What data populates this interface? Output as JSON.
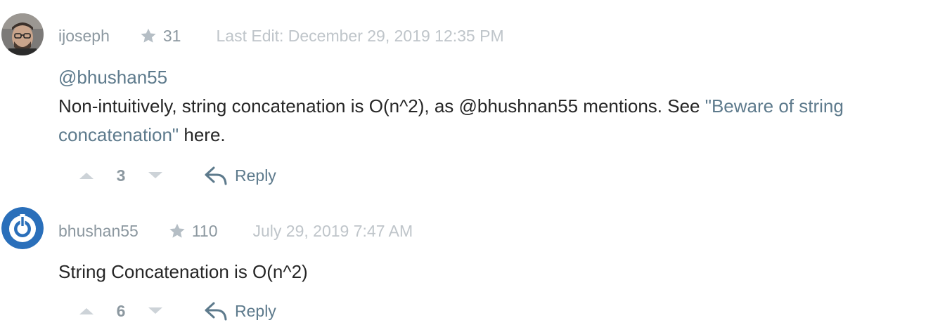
{
  "comments": [
    {
      "username": "ijoseph",
      "reputation": "31",
      "timestamp": "Last Edit: December 29, 2019 12:35 PM",
      "mention": "@bhushan55",
      "text_before": "Non-intuitively, string concatenation is O(n^2), as @bhushnan55 mentions. See ",
      "link_text": "\"Beware of string concatenation\"",
      "text_after": " here.",
      "votes": "3",
      "reply_label": "Reply"
    },
    {
      "username": "bhushan55",
      "reputation": "110",
      "timestamp": "July 29, 2019 7:47 AM",
      "text": "String Concatenation is O(n^2)",
      "votes": "6",
      "reply_label": "Reply"
    }
  ],
  "colors": {
    "accent_link": "#5d7a8c",
    "muted": "#8c98a0",
    "timestamp": "#bfc5ca",
    "text": "#262626",
    "vote_arrow": "#cdd3d8",
    "avatar_blue": "#2a6fba"
  },
  "icons": {
    "star": "star-icon",
    "upvote": "chevron-up-icon",
    "downvote": "chevron-down-icon",
    "reply": "reply-arrow-icon"
  }
}
